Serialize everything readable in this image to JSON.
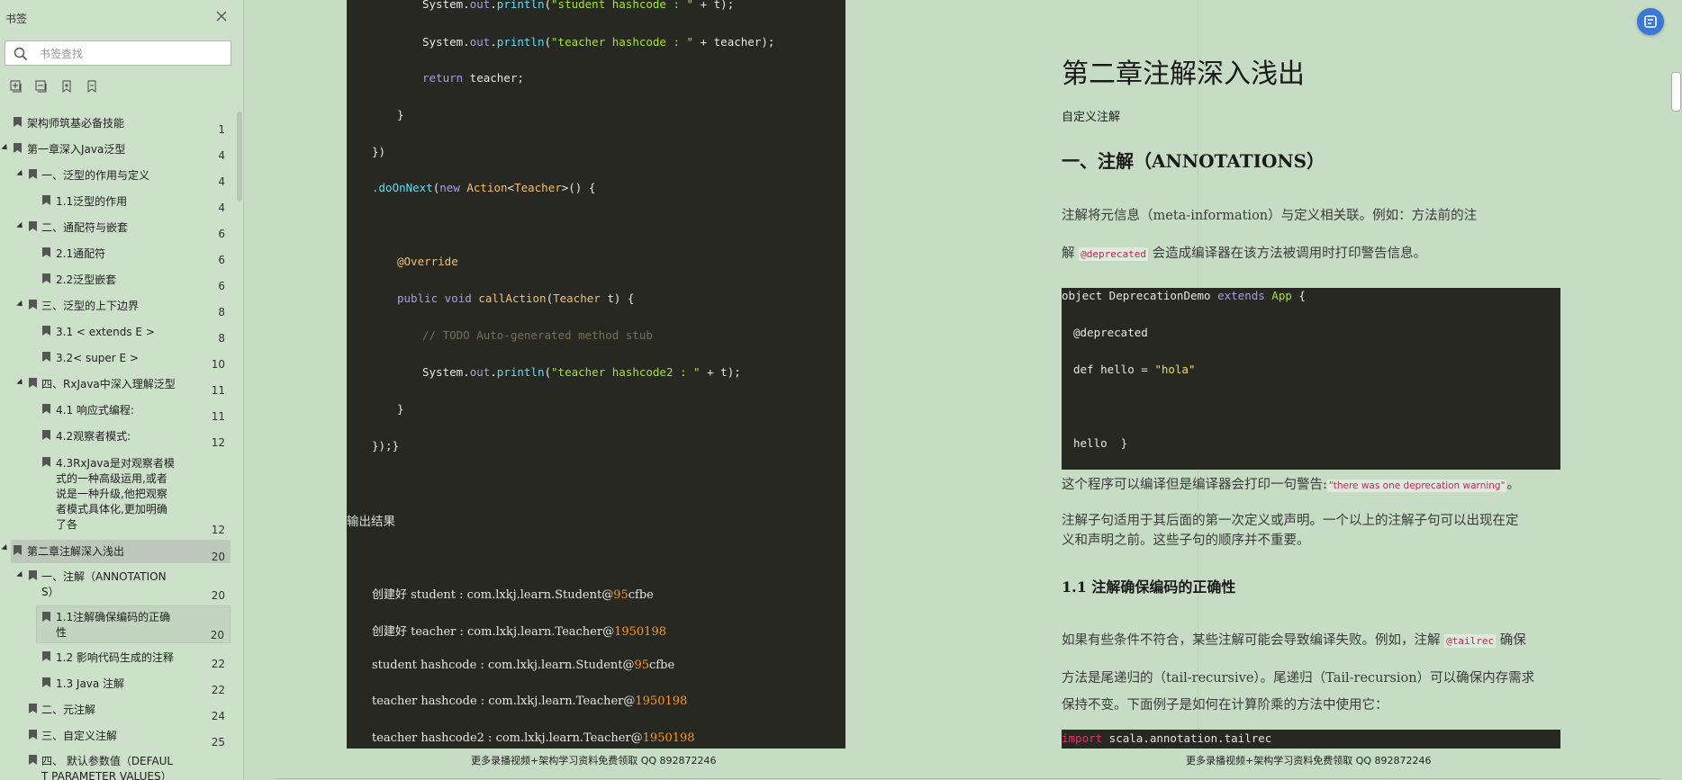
{
  "sidebar": {
    "title": "书签",
    "search_placeholder": "书签查找",
    "items": [
      {
        "label": "架构师筑基必备技能",
        "page": "1"
      },
      {
        "label": "第一章深入Java泛型",
        "page": "4"
      },
      {
        "label": "一、泛型的作用与定义",
        "page": "4"
      },
      {
        "label": "1.1泛型的作用",
        "page": "4"
      },
      {
        "label": "二、通配符与嵌套",
        "page": "6"
      },
      {
        "label": "2.1通配符",
        "page": "6"
      },
      {
        "label": "2.2泛型嵌套",
        "page": "6"
      },
      {
        "label": "三、泛型的上下边界",
        "page": "8"
      },
      {
        "label": "3.1 < extends E >",
        "page": "8"
      },
      {
        "label": "3.2< super E >",
        "page": "10"
      },
      {
        "label": "四、RxJava中深入理解泛型",
        "page": "11"
      },
      {
        "label": "4.1 响应式编程:",
        "page": "11"
      },
      {
        "label": "4.2观察者模式:",
        "page": "12"
      },
      {
        "label_lines": [
          "4.3RxJava是对观察者模",
          "式的一种高级运用,或者",
          "说是一种升级,他把观察",
          "者模式具体化,更加明确",
          "了各"
        ],
        "page": "12"
      },
      {
        "label": "第二章注解深入浅出",
        "page": "20"
      },
      {
        "label_lines": [
          "一、注解（ANNOTATION",
          "S）"
        ],
        "page": "20"
      },
      {
        "label_lines": [
          "1.1注解确保编码的正确",
          "性"
        ],
        "page": "20"
      },
      {
        "label": "1.2 影响代码生成的注释",
        "page": "22"
      },
      {
        "label": "1.3 Java 注解",
        "page": "22"
      },
      {
        "label": "二、元注解",
        "page": "24"
      },
      {
        "label": "三、自定义注解",
        "page": "25"
      },
      {
        "label_lines": [
          "四、 默认参数值（DEFAUL",
          "T PARAMETER VALUES）"
        ],
        "page": ""
      }
    ]
  },
  "left_page": {
    "code": {
      "l1_a": "System.",
      "l1_b": "out",
      "l1_c": ".",
      "l1_d": "println",
      "l1_e": "(",
      "l1_f": "\"student hashcode : \"",
      "l1_g": " + t);",
      "l2_f": "\"teacher hashcode : \"",
      "l2_g": " + teacher);",
      "l3_kw": "return",
      "l3_rest": " teacher;",
      "l4": "}",
      "l5": "})",
      "l6_a": ".doOnNext",
      "l6_b": "(",
      "l6_c": "new",
      "l6_d": " Action",
      "l6_e": "<",
      "l6_f": "Teacher",
      "l6_g": ">() {",
      "l7": "@Override",
      "l8_a": "public void ",
      "l8_b": "callAction",
      "l8_c": "(",
      "l8_d": "Teacher",
      "l8_e": " t) {",
      "l9": "// TODO Auto-generated method stub",
      "l10_f": "\"teacher hashcode2 : \"",
      "l10_g": " + t);",
      "l11": "}",
      "l12": "});}"
    },
    "output_label": "输出结果",
    "output": [
      {
        "text": "创建好 student : com.lxkj.learn.Student@",
        "num": "95",
        "tail": "cfbe"
      },
      {
        "text": "创建好 teacher : com.lxkj.learn.Teacher@",
        "num": "1950198",
        "tail": ""
      },
      {
        "text": "student hashcode : com.lxkj.learn.Student@",
        "num": "95",
        "tail": "cfbe"
      },
      {
        "text": "teacher hashcode : com.lxkj.learn.Teacher@",
        "num": "1950198",
        "tail": ""
      },
      {
        "text": "teacher hashcode2 : com.lxkj.learn.Teacher@",
        "num": "1950198",
        "tail": ""
      }
    ],
    "footer": "更多录播视频+架构学习资料免费领取  QQ 892872246"
  },
  "right_page": {
    "title": "第二章注解深入浅出",
    "subtitle": "自定义注解",
    "h2": "一、注解（ANNOTATIONS）",
    "p1_a": "注解将元信息（meta-information）与定义相关联。例如：方法前的注",
    "p1_b1": "解",
    "p1_code": "@deprecated",
    "p1_b2": "会造成编译器在该方法被调用时打印警告信息。",
    "code1": {
      "a1": "object DeprecationDemo ",
      "a2": "extends",
      "a3": " App",
      "a4": " {",
      "b": "@deprecated",
      "c1": "def hello = ",
      "c2": "\"hola\"",
      "d": "hello  }"
    },
    "p2_a": "这个程序可以编译但是编译器会打印一句警告:",
    "p2_code": "\"there was one deprecation warning\"",
    "p2_b": "。",
    "p3_a": "注解子句适用于其后面的第一次定义或声明。一个以上的注解子句可以出现在定",
    "p3_b": "义和声明之前。这些子句的顺序并不重要。",
    "h3": "1.1 注解确保编码的正确性",
    "p4_a1": "如果有些条件不符合，某些注解可能会导致编译失败。例如，注解",
    "p4_code": "@tailrec",
    "p4_a2": "确保",
    "p4_b": "方法是尾递归的（tail-recursive）。尾递归（Tail-recursion）可以确保内存需求",
    "p4_c": "保持不变。下面例子是如何在计算阶乘的方法中使用它：",
    "code2_kw": "import",
    "code2_rest": " scala.annotation.tailrec",
    "footer": "更多录播视频+架构学习资料免费领取  QQ 892872246"
  }
}
